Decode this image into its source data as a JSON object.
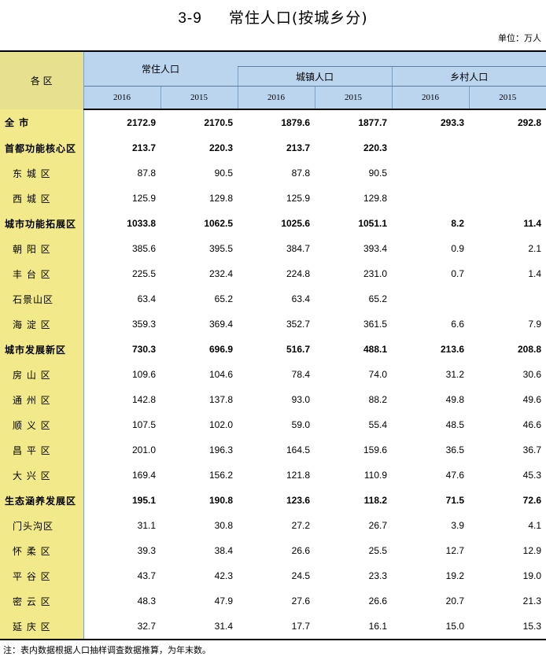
{
  "title": {
    "number": "3-9",
    "text": "常住人口(按城乡分)"
  },
  "unit": "单位：万人",
  "header": {
    "region": "各  区",
    "groups": [
      "常住人口",
      "城镇人口",
      "乡村人口"
    ],
    "years": [
      "2016",
      "2015",
      "2016",
      "2015",
      "2016",
      "2015"
    ]
  },
  "rows": [
    {
      "name": "全      市",
      "bold": true,
      "indent": false,
      "values": [
        "2172.9",
        "2170.5",
        "1879.6",
        "1877.7",
        "293.3",
        "292.8"
      ]
    },
    {
      "name": "首都功能核心区",
      "bold": true,
      "indent": false,
      "values": [
        "213.7",
        "220.3",
        "213.7",
        "220.3",
        "",
        ""
      ]
    },
    {
      "name": "东 城 区",
      "bold": false,
      "indent": true,
      "values": [
        "87.8",
        "90.5",
        "87.8",
        "90.5",
        "",
        ""
      ]
    },
    {
      "name": "西 城 区",
      "bold": false,
      "indent": true,
      "values": [
        "125.9",
        "129.8",
        "125.9",
        "129.8",
        "",
        ""
      ]
    },
    {
      "name": "城市功能拓展区",
      "bold": true,
      "indent": false,
      "values": [
        "1033.8",
        "1062.5",
        "1025.6",
        "1051.1",
        "8.2",
        "11.4"
      ]
    },
    {
      "name": "朝 阳 区",
      "bold": false,
      "indent": true,
      "values": [
        "385.6",
        "395.5",
        "384.7",
        "393.4",
        "0.9",
        "2.1"
      ]
    },
    {
      "name": "丰 台 区",
      "bold": false,
      "indent": true,
      "values": [
        "225.5",
        "232.4",
        "224.8",
        "231.0",
        "0.7",
        "1.4"
      ]
    },
    {
      "name": "石景山区",
      "bold": false,
      "indent": true,
      "values": [
        "63.4",
        "65.2",
        "63.4",
        "65.2",
        "",
        ""
      ]
    },
    {
      "name": "海 淀 区",
      "bold": false,
      "indent": true,
      "values": [
        "359.3",
        "369.4",
        "352.7",
        "361.5",
        "6.6",
        "7.9"
      ]
    },
    {
      "name": "城市发展新区",
      "bold": true,
      "indent": false,
      "values": [
        "730.3",
        "696.9",
        "516.7",
        "488.1",
        "213.6",
        "208.8"
      ]
    },
    {
      "name": "房 山 区",
      "bold": false,
      "indent": true,
      "values": [
        "109.6",
        "104.6",
        "78.4",
        "74.0",
        "31.2",
        "30.6"
      ]
    },
    {
      "name": "通 州 区",
      "bold": false,
      "indent": true,
      "values": [
        "142.8",
        "137.8",
        "93.0",
        "88.2",
        "49.8",
        "49.6"
      ]
    },
    {
      "name": "顺 义 区",
      "bold": false,
      "indent": true,
      "values": [
        "107.5",
        "102.0",
        "59.0",
        "55.4",
        "48.5",
        "46.6"
      ]
    },
    {
      "name": "昌 平 区",
      "bold": false,
      "indent": true,
      "values": [
        "201.0",
        "196.3",
        "164.5",
        "159.6",
        "36.5",
        "36.7"
      ]
    },
    {
      "name": "大 兴 区",
      "bold": false,
      "indent": true,
      "values": [
        "169.4",
        "156.2",
        "121.8",
        "110.9",
        "47.6",
        "45.3"
      ]
    },
    {
      "name": "生态涵养发展区",
      "bold": true,
      "indent": false,
      "values": [
        "195.1",
        "190.8",
        "123.6",
        "118.2",
        "71.5",
        "72.6"
      ]
    },
    {
      "name": "门头沟区",
      "bold": false,
      "indent": true,
      "values": [
        "31.1",
        "30.8",
        "27.2",
        "26.7",
        "3.9",
        "4.1"
      ]
    },
    {
      "name": "怀 柔 区",
      "bold": false,
      "indent": true,
      "values": [
        "39.3",
        "38.4",
        "26.6",
        "25.5",
        "12.7",
        "12.9"
      ]
    },
    {
      "name": "平 谷 区",
      "bold": false,
      "indent": true,
      "values": [
        "43.7",
        "42.3",
        "24.5",
        "23.3",
        "19.2",
        "19.0"
      ]
    },
    {
      "name": "密 云 区",
      "bold": false,
      "indent": true,
      "values": [
        "48.3",
        "47.9",
        "27.6",
        "26.6",
        "20.7",
        "21.3"
      ]
    },
    {
      "name": "延 庆 区",
      "bold": false,
      "indent": true,
      "values": [
        "32.7",
        "31.4",
        "17.7",
        "16.1",
        "15.0",
        "15.3"
      ]
    }
  ],
  "note": "注：表内数据根据人口抽样调查数据推算，为年末数。"
}
